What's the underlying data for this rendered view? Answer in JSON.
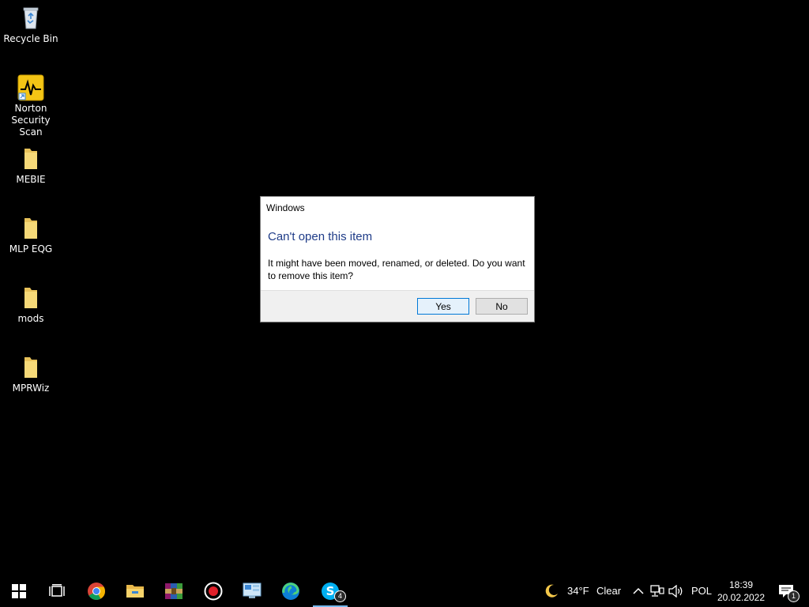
{
  "desktop": {
    "icons": [
      {
        "label": "Recycle Bin",
        "icon": "recycle-bin-icon"
      },
      {
        "label": "Norton Security Scan",
        "icon": "norton-icon"
      },
      {
        "label": "MEBIE",
        "icon": "folder-icon"
      },
      {
        "label": "MLP EQG",
        "icon": "folder-icon"
      },
      {
        "label": "mods",
        "icon": "folder-icon"
      },
      {
        "label": "MPRWiz",
        "icon": "folder-icon"
      }
    ]
  },
  "dialog": {
    "title": "Windows",
    "heading": "Can't open this item",
    "message": "It might have been moved, renamed, or deleted. Do you want to remove this item?",
    "yes_label": "Yes",
    "no_label": "No"
  },
  "taskbar": {
    "apps": [
      {
        "icon": "start-icon"
      },
      {
        "icon": "task-view-icon"
      },
      {
        "icon": "chrome-icon"
      },
      {
        "icon": "file-explorer-icon"
      },
      {
        "icon": "winrar-icon"
      },
      {
        "icon": "record-icon"
      },
      {
        "icon": "control-panel-icon"
      },
      {
        "icon": "edge-icon"
      },
      {
        "icon": "skype-icon",
        "badge": "4"
      }
    ],
    "weather": {
      "temp": "34°F",
      "condition": "Clear",
      "icon": "moon-icon"
    },
    "language": "POL",
    "time": "18:39",
    "date": "20.02.2022",
    "notification_count": "1"
  },
  "colors": {
    "accent": "#0078d7",
    "heading": "#1f3c88",
    "folder": "#e8c25a"
  }
}
